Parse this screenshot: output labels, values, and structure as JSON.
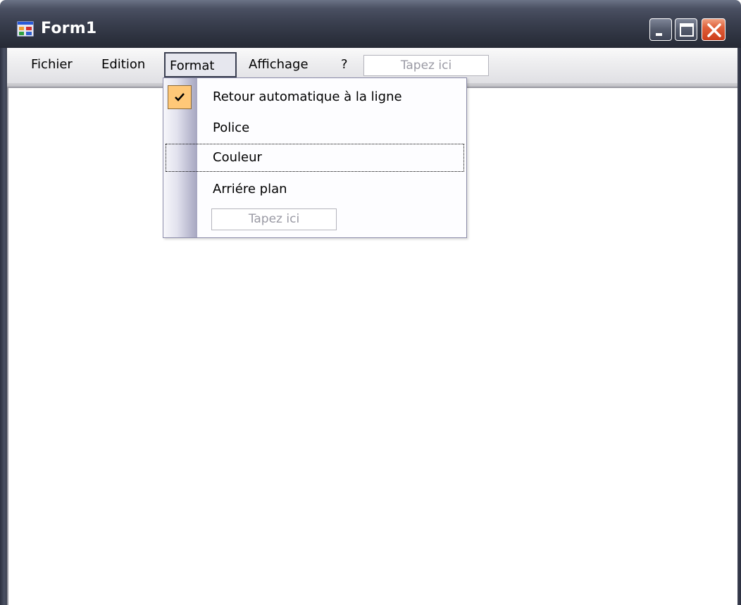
{
  "window": {
    "title": "Form1"
  },
  "menubar": {
    "items": [
      {
        "label": "Fichier"
      },
      {
        "label": "Edition"
      },
      {
        "label": "Format"
      },
      {
        "label": "Affichage"
      },
      {
        "label": "?"
      }
    ],
    "type_here_placeholder": "Tapez ici"
  },
  "format_menu": {
    "items": [
      {
        "label": "Retour automatique à la ligne",
        "checked": true
      },
      {
        "label": "Police",
        "checked": false
      },
      {
        "label": "Couleur",
        "checked": false,
        "focused": true
      },
      {
        "label": "Arriére plan",
        "checked": false
      }
    ],
    "type_here_placeholder": "Tapez ici"
  },
  "colors": {
    "titlebar": "#3b4050",
    "close_button": "#e0603a",
    "check_highlight": "#ffc878",
    "menubar": "#eeeef0"
  },
  "icons": {
    "app": "form-app-icon",
    "minimize": "minimize-icon",
    "maximize": "maximize-icon",
    "close": "close-icon",
    "check": "checkmark-icon"
  }
}
